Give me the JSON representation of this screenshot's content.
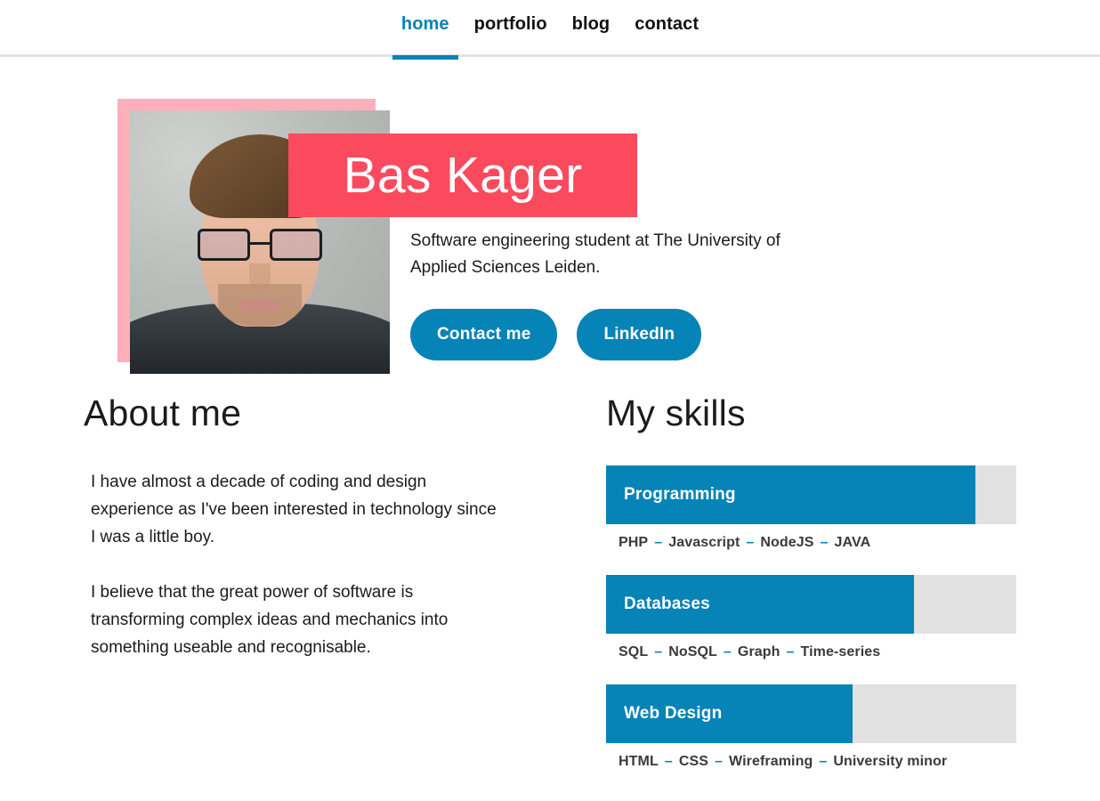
{
  "nav": {
    "items": [
      {
        "label": "home",
        "active": true
      },
      {
        "label": "portfolio",
        "active": false
      },
      {
        "label": "blog",
        "active": false
      },
      {
        "label": "contact",
        "active": false
      }
    ]
  },
  "hero": {
    "name": "Bas Kager",
    "tagline": "Software engineering student at The University of Applied Sciences Leiden.",
    "buttons": [
      {
        "label": "Contact me"
      },
      {
        "label": "LinkedIn"
      }
    ],
    "photo_alt": "portrait-photo"
  },
  "about": {
    "title": "About me",
    "paragraphs": [
      "I have almost a decade of coding and design experience as I've been interested in technology since I was a little boy.",
      "I believe that the great power of software is transforming complex ideas and mechanics into something useable and recognisable."
    ]
  },
  "skills": {
    "title": "My skills",
    "items": [
      {
        "name": "Programming",
        "percent": 90,
        "tags": [
          "PHP",
          "Javascript",
          "NodeJS",
          "JAVA"
        ],
        "separator": "–"
      },
      {
        "name": "Databases",
        "percent": 75,
        "tags": [
          "SQL",
          "NoSQL",
          "Graph",
          "Time-series"
        ],
        "separator": "–"
      },
      {
        "name": "Web Design",
        "percent": 60,
        "tags": [
          "HTML",
          "CSS",
          "Wireframing",
          "University minor"
        ],
        "separator": "–"
      }
    ]
  },
  "colors": {
    "accent_blue": "#0683b7",
    "coral": "#fb4a5e",
    "pink": "#ffafbc",
    "track_gray": "#e1e1e1",
    "text": "#1b1b1b"
  }
}
